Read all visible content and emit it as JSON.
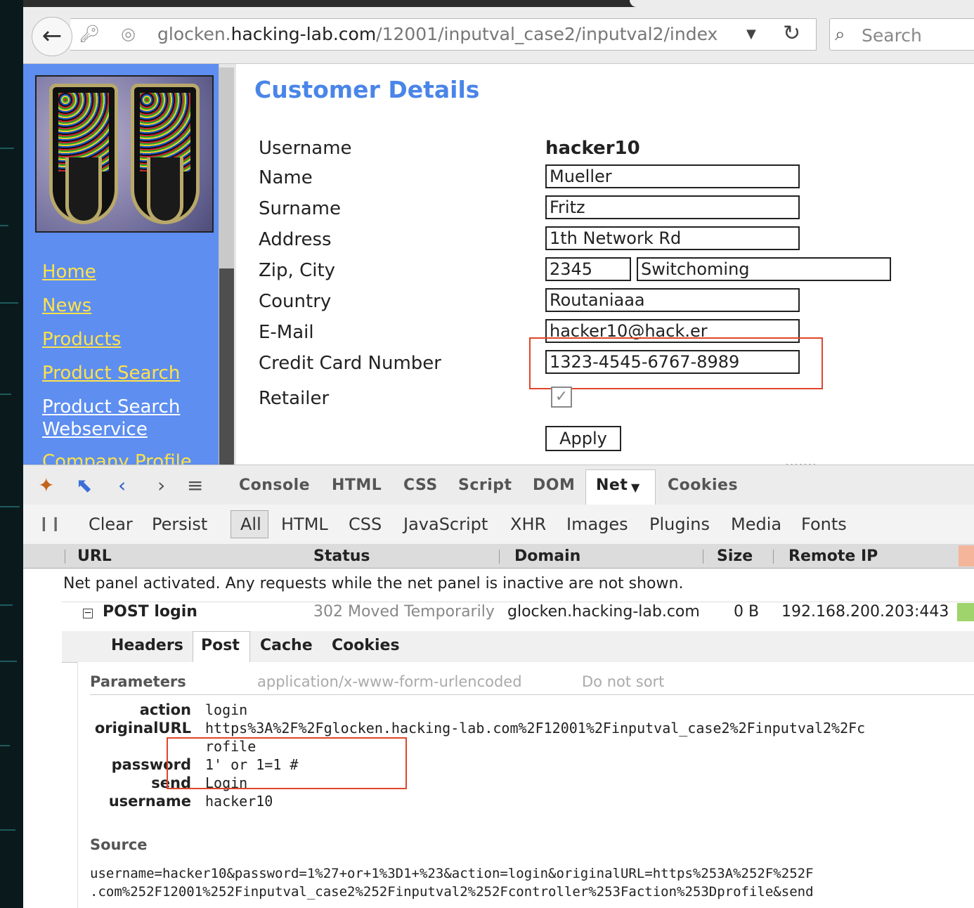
{
  "browser": {
    "url_prefix": "glocken.",
    "url_domain": "hacking-lab.com",
    "url_path": "/12001/inputval_case2/inputval2/index",
    "search_placeholder": "Search"
  },
  "sidebar": {
    "links": [
      "Home",
      "News",
      "Products",
      "Product Search",
      "Product Search",
      "Webservice",
      "Company Profile"
    ]
  },
  "page": {
    "title": "Customer Details",
    "labels": [
      "Username",
      "Name",
      "Surname",
      "Address",
      "Zip, City",
      "Country",
      "E-Mail",
      "Credit Card Number",
      "Retailer"
    ],
    "username": "hacker10",
    "name": "Mueller",
    "surname": "Fritz",
    "address": "1th Network Rd",
    "zip": "2345",
    "city": "Switchoming",
    "country": "Routaniaaa",
    "email": "hacker10@hack.er",
    "credit_card": "1323-4545-6767-8989",
    "retailer_checked": true,
    "apply_label": "Apply",
    "dots": "......."
  },
  "firebug": {
    "tabs": [
      "Console",
      "HTML",
      "CSS",
      "Script",
      "DOM",
      "Net",
      "Cookies"
    ],
    "active_tab": "Net",
    "toolbar": [
      "Clear",
      "Persist"
    ],
    "filters": [
      "All",
      "HTML",
      "CSS",
      "JavaScript",
      "XHR",
      "Images",
      "Plugins",
      "Media",
      "Fonts"
    ],
    "columns": [
      "URL",
      "Status",
      "Domain",
      "Size",
      "Remote IP"
    ],
    "note": "Net panel activated. Any requests while the net panel is inactive are not shown.",
    "request": {
      "method_url": "POST login",
      "status": "302 Moved Temporarily",
      "domain": "glocken.hacking-lab.com",
      "size": "0 B",
      "remote_ip": "192.168.200.203:443"
    },
    "subtabs": [
      "Headers",
      "Post",
      "Cache",
      "Cookies"
    ],
    "params_header": "Parameters",
    "params_type": "application/x-www-form-urlencoded",
    "params_sort": "Do not sort",
    "params": [
      {
        "key": "action",
        "value": "login"
      },
      {
        "key": "originalURL",
        "value": "https%3A%2F%2Fglocken.hacking-lab.com%2F12001%2Finputval_case2%2Finputval2%2Fc"
      },
      {
        "key": "",
        "value": "rofile"
      },
      {
        "key": "password",
        "value": "1' or 1=1 #"
      },
      {
        "key": "send",
        "value": "Login"
      },
      {
        "key": "username",
        "value": "hacker10"
      }
    ],
    "source_header": "Source",
    "source_lines": [
      "username=hacker10&password=1%27+or+1%3D1+%23&action=login&originalURL=https%253A%252F%252F",
      ".com%252F12001%252Finputval_case2%252Finputval2%252Fcontroller%253Faction%253Dprofile&send"
    ]
  }
}
